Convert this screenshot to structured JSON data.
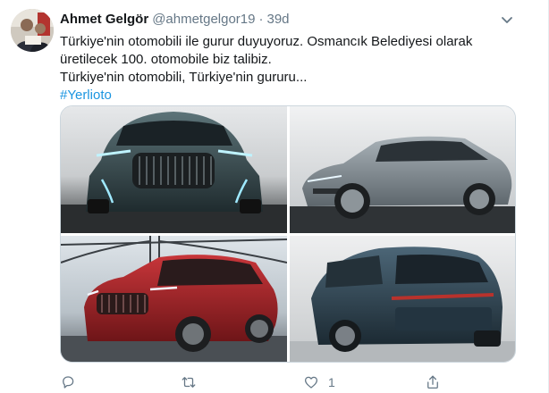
{
  "tweet": {
    "author_name": "Ahmet Gelgör",
    "handle": "@ahmetgelgor19",
    "separator": "·",
    "time": "39d",
    "text_lines": [
      "Türkiye'nin otomobili ile gurur duyuyoruz. Osmancık Belediyesi olarak",
      "üretilecek 100. otomobile biz talibiz.",
      "Türkiye'nin otomobili, Türkiye'nin gururu..."
    ],
    "hashtag": "#Yerlioto",
    "photos": [
      {
        "icon": "car-photo-front-teal"
      },
      {
        "icon": "car-photo-sedan-silver"
      },
      {
        "icon": "car-photo-suv-red"
      },
      {
        "icon": "car-photo-suv-rear-blue"
      }
    ],
    "actions": {
      "reply_count": "",
      "retweet_count": "",
      "like_count": "1",
      "share_count": ""
    }
  },
  "colors": {
    "text_primary": "#14171a",
    "text_secondary": "#657786",
    "link": "#1b95e0",
    "border": "#ccd6dd"
  }
}
